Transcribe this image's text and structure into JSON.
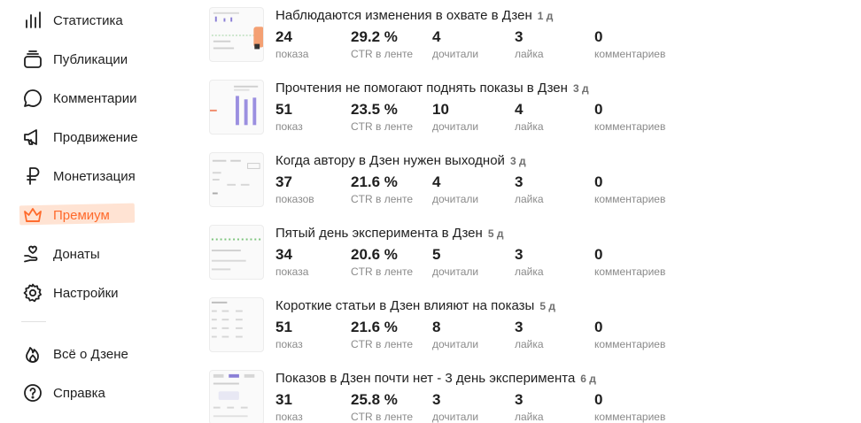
{
  "sidebar": {
    "items": [
      {
        "label": "Статистика",
        "icon": "bar-chart-icon"
      },
      {
        "label": "Публикации",
        "icon": "stack-icon"
      },
      {
        "label": "Комментарии",
        "icon": "comment-icon"
      },
      {
        "label": "Продвижение",
        "icon": "megaphone-icon"
      },
      {
        "label": "Монетизация",
        "icon": "ruble-icon"
      },
      {
        "label": "Премиум",
        "icon": "crown-icon",
        "accent": "#ff6a2b"
      },
      {
        "label": "Донаты",
        "icon": "hand-heart-icon"
      },
      {
        "label": "Настройки",
        "icon": "gear-icon"
      }
    ],
    "secondary": [
      {
        "label": "Всё о Дзене",
        "icon": "flame-icon"
      },
      {
        "label": "Справка",
        "icon": "help-icon"
      }
    ]
  },
  "publications": [
    {
      "title": "Наблюдаются изменения в охвате в Дзен",
      "age": "1 д",
      "stats": [
        {
          "value": "24",
          "label": "показа"
        },
        {
          "value": "29.2 %",
          "label": "CTR в ленте"
        },
        {
          "value": "4",
          "label": "дочитали"
        },
        {
          "value": "3",
          "label": "лайка"
        },
        {
          "value": "0",
          "label": "комментариев"
        }
      ]
    },
    {
      "title": "Прочтения не помогают поднять показы в Дзен",
      "age": "3 д",
      "stats": [
        {
          "value": "51",
          "label": "показ"
        },
        {
          "value": "23.5 %",
          "label": "CTR в ленте"
        },
        {
          "value": "10",
          "label": "дочитали"
        },
        {
          "value": "4",
          "label": "лайка"
        },
        {
          "value": "0",
          "label": "комментариев"
        }
      ]
    },
    {
      "title": "Когда автору в Дзен нужен выходной",
      "age": "3 д",
      "stats": [
        {
          "value": "37",
          "label": "показов"
        },
        {
          "value": "21.6 %",
          "label": "CTR в ленте"
        },
        {
          "value": "4",
          "label": "дочитали"
        },
        {
          "value": "3",
          "label": "лайка"
        },
        {
          "value": "0",
          "label": "комментариев"
        }
      ]
    },
    {
      "title": "Пятый день эксперимента в Дзен",
      "age": "5 д",
      "stats": [
        {
          "value": "34",
          "label": "показа"
        },
        {
          "value": "20.6 %",
          "label": "CTR в ленте"
        },
        {
          "value": "5",
          "label": "дочитали"
        },
        {
          "value": "3",
          "label": "лайка"
        },
        {
          "value": "0",
          "label": "комментариев"
        }
      ]
    },
    {
      "title": "Короткие статьи в Дзен влияют на показы",
      "age": "5 д",
      "stats": [
        {
          "value": "51",
          "label": "показ"
        },
        {
          "value": "21.6 %",
          "label": "CTR в ленте"
        },
        {
          "value": "8",
          "label": "дочитали"
        },
        {
          "value": "3",
          "label": "лайка"
        },
        {
          "value": "0",
          "label": "комментариев"
        }
      ]
    },
    {
      "title": "Показов в Дзен почти нет - 3 день эксперимента",
      "age": "6 д",
      "stats": [
        {
          "value": "31",
          "label": "показ"
        },
        {
          "value": "25.8 %",
          "label": "CTR в ленте"
        },
        {
          "value": "3",
          "label": "дочитали"
        },
        {
          "value": "3",
          "label": "лайка"
        },
        {
          "value": "0",
          "label": "комментариев"
        }
      ]
    }
  ]
}
